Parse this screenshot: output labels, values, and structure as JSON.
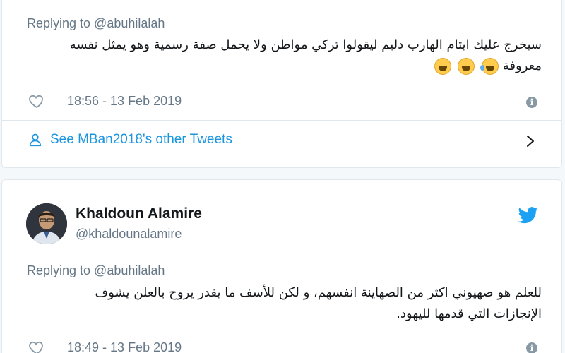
{
  "tweet1": {
    "replying_to": "Replying to @abuhilalah",
    "text_line1": "سيخرج عليك ايتام الهارب دليم ليقولوا تركي مواطن ولا يحمل صفة رسمية وهو يمثل نفسه",
    "text_line2": "معروفة",
    "emojis": [
      "face-with-tears-of-joy",
      "grinning-squinting-face",
      "grinning-face"
    ],
    "timestamp": "18:56 - 13 Feb 2019",
    "see_more_label": "See MBan2018's other Tweets"
  },
  "tweet2": {
    "author_name": "Khaldoun Alamire",
    "author_handle": "@khaldounalamire",
    "replying_to": "Replying to @abuhilalah",
    "text_line1": "للعلم هو صهيوني اكثر من الصهاينة انفسهم، و لكن للأسف ما يقدر يروح بالعلن يشوف",
    "text_line2": "الإنجازات التي قدمها لليهود.",
    "timestamp": "18:49 - 13 Feb 2019"
  },
  "colors": {
    "brand_blue": "#1da1f2",
    "link_blue": "#1b95e0",
    "secondary_text": "#657786",
    "primary_text": "#14171a",
    "border": "#e1e8ed"
  },
  "icons": {
    "like": "heart-icon",
    "info": "info-icon",
    "person": "person-icon",
    "chevron": "chevron-right-icon",
    "twitter": "twitter-bird-icon"
  }
}
